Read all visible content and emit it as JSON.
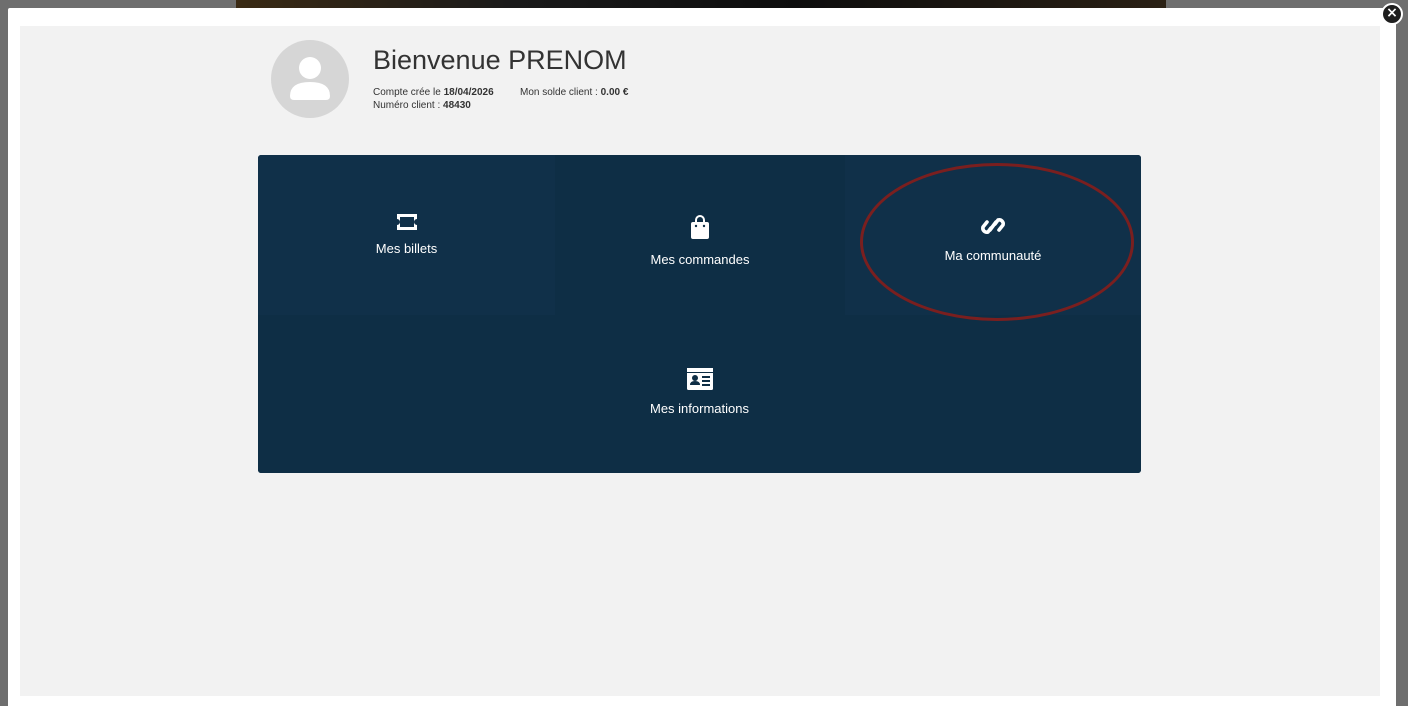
{
  "header": {
    "welcome": "Bienvenue PRENOM",
    "account_created_label": "Compte crée le",
    "account_created_date": "18/04/2026",
    "balance_label": "Mon solde client :",
    "balance_value": "0.00 €",
    "client_number_label": "Numéro client :",
    "client_number_value": "48430"
  },
  "tiles": [
    {
      "label": "Mes billets",
      "icon": "ticket-icon"
    },
    {
      "label": "Mes commandes",
      "icon": "shopping-bag-icon"
    },
    {
      "label": "Ma communauté",
      "icon": "link-icon"
    },
    {
      "label": "Mes informations",
      "icon": "id-card-icon"
    }
  ],
  "close": {
    "glyph": "×"
  },
  "colors": {
    "tile_background": "#0e2e45",
    "modal_background": "#f2f2f2",
    "highlight": "#7a1f1f"
  }
}
